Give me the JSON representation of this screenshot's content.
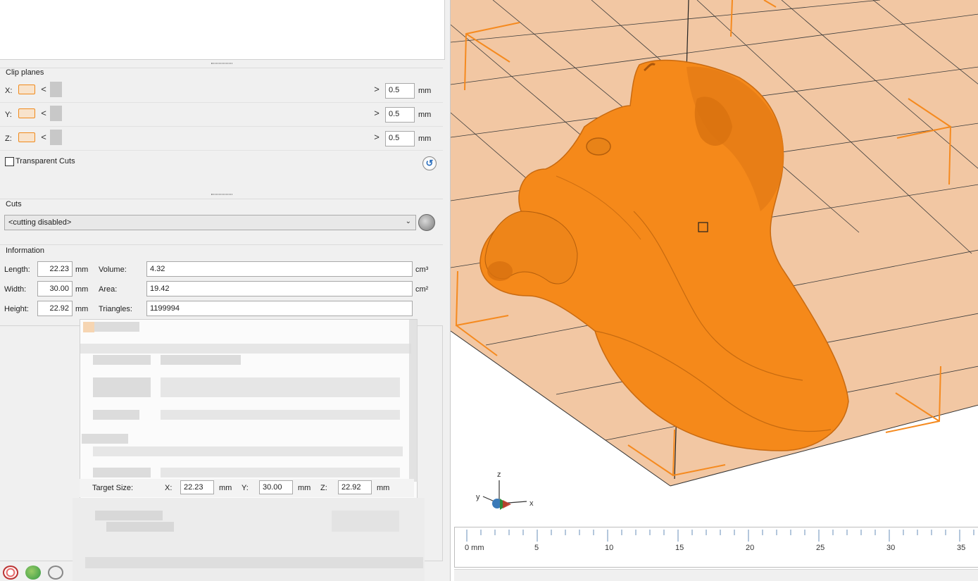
{
  "clip_planes": {
    "title": "Clip planes",
    "rows": [
      {
        "axis": "X:",
        "value": "0.5",
        "unit": "mm"
      },
      {
        "axis": "Y:",
        "value": "0.5",
        "unit": "mm"
      },
      {
        "axis": "Z:",
        "value": "0.5",
        "unit": "mm"
      }
    ],
    "left_arrow": "<",
    "right_arrow": ">",
    "transparent_cuts_label": "Transparent Cuts",
    "transparent_cuts_checked": false
  },
  "cuts": {
    "title": "Cuts",
    "selected": "<cutting disabled>"
  },
  "information": {
    "title": "Information",
    "length_label": "Length:",
    "length_value": "22.23",
    "length_unit": "mm",
    "width_label": "Width:",
    "width_value": "30.00",
    "width_unit": "mm",
    "height_label": "Height:",
    "height_value": "22.92",
    "height_unit": "mm",
    "volume_label": "Volume:",
    "volume_value": "4.32",
    "volume_unit": "cm³",
    "area_label": "Area:",
    "area_value": "19.42",
    "area_unit": "cm²",
    "triangles_label": "Triangles:",
    "triangles_value": "1199994"
  },
  "target_size": {
    "label": "Target Size:",
    "x_label": "X:",
    "x_value": "22.23",
    "x_unit": "mm",
    "y_label": "Y:",
    "y_value": "30.00",
    "y_unit": "mm",
    "z_label": "Z:",
    "z_value": "22.92",
    "z_unit": "mm"
  },
  "viewport": {
    "axis_labels": {
      "x": "x",
      "y": "y",
      "z": "z"
    },
    "ruler_labels": [
      "0 mm",
      "5",
      "10",
      "15",
      "20",
      "25",
      "30",
      "35"
    ],
    "model_color": "#f5891a",
    "bed_color": "#f2c7a3",
    "bbox_color": "#f58a1f"
  },
  "toolbar_icons": [
    "settings-icon",
    "warning-icon",
    "link-icon"
  ]
}
